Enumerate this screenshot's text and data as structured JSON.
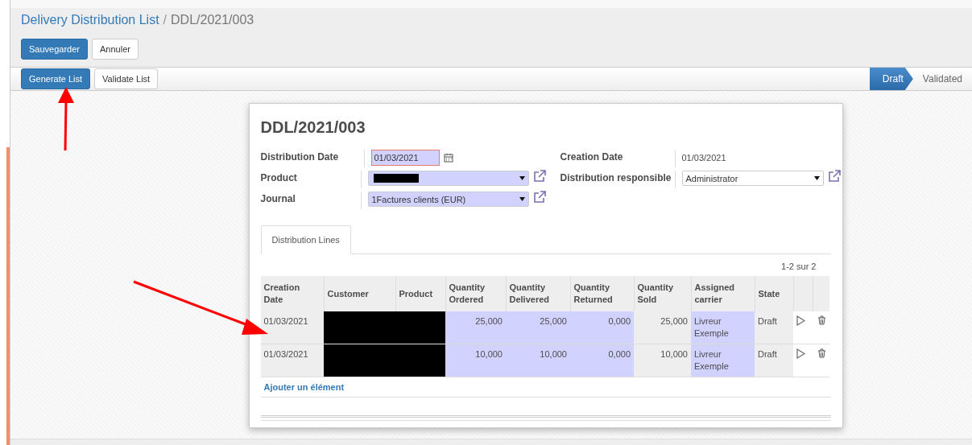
{
  "breadcrumb": [
    {
      "label": "Delivery Distribution List",
      "kind": "link"
    },
    {
      "label": "DDL/2021/003",
      "kind": "current"
    }
  ],
  "breadcrumb_separator": "/",
  "edit_buttons": [
    {
      "label": "Sauvegarder",
      "kind": "primary"
    },
    {
      "label": "Annuler",
      "kind": "default"
    }
  ],
  "action_buttons": [
    {
      "label": "Generate List",
      "kind": "primary"
    },
    {
      "label": "Validate List",
      "kind": "default"
    }
  ],
  "status_steps": [
    {
      "label": "Draft",
      "selected": true
    },
    {
      "label": "Validated",
      "selected": false
    }
  ],
  "form": {
    "title": "DDL/2021/003",
    "left_fields": [
      {
        "label": "Distribution Date",
        "kind": "date",
        "value": "01/03/2021",
        "highlighted": true
      },
      {
        "label": "Product",
        "kind": "select",
        "redacted": true,
        "required": true
      },
      {
        "label": "Journal",
        "kind": "select",
        "value": "1Factures clients (EUR)",
        "required": true
      }
    ],
    "right_fields": [
      {
        "label": "Creation Date",
        "kind": "text",
        "value": "01/03/2021"
      },
      {
        "label": "Distribution responsible",
        "kind": "select",
        "value": "Administrator",
        "required": false
      }
    ]
  },
  "tabs": [
    {
      "label": "Distribution Lines",
      "selected": true
    }
  ],
  "pager": "1-2 sur 2",
  "table": {
    "columns": [
      {
        "label": "Creation Date",
        "required": false,
        "numeric": false
      },
      {
        "label": "Customer",
        "required": true,
        "numeric": false
      },
      {
        "label": "Product",
        "required": true,
        "numeric": false
      },
      {
        "label": "Quantity Ordered",
        "required": true,
        "numeric": true
      },
      {
        "label": "Quantity Delivered",
        "required": true,
        "numeric": true
      },
      {
        "label": "Quantity Returned",
        "required": true,
        "numeric": true
      },
      {
        "label": "Quantity Sold",
        "required": false,
        "numeric": true
      },
      {
        "label": "Assigned carrier",
        "required": true,
        "numeric": false
      },
      {
        "label": "State",
        "required": false,
        "numeric": false
      }
    ],
    "rows": [
      {
        "cells": [
          {
            "text": "01/03/2021"
          },
          {
            "redacted": true
          },
          {
            "redacted": true
          },
          {
            "text": "25,000"
          },
          {
            "text": "25,000"
          },
          {
            "text": "0,000"
          },
          {
            "text": "25,000"
          },
          {
            "text": "Livreur Exemple"
          },
          {
            "text": "Draft"
          }
        ]
      },
      {
        "cells": [
          {
            "text": "01/03/2021"
          },
          {
            "redacted": true
          },
          {
            "redacted": true
          },
          {
            "text": "10,000"
          },
          {
            "text": "10,000"
          },
          {
            "text": "0,000"
          },
          {
            "text": "10,000"
          },
          {
            "text": "Livreur Exemple"
          },
          {
            "text": "Draft"
          }
        ]
      }
    ],
    "add_line": "Ajouter un élément"
  },
  "annotations": [
    {
      "kind": "arrow"
    },
    {
      "kind": "arrow"
    }
  ]
}
